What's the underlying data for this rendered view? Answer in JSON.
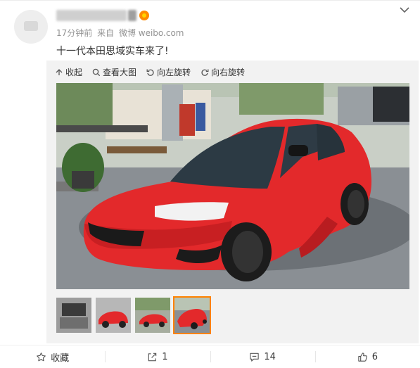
{
  "post": {
    "time_ago": "17分钟前",
    "source_prefix": "来自",
    "source": "微博 weibo.com",
    "text": "十一代本田思域实车来了!"
  },
  "toolbar": {
    "collapse": "收起",
    "view_large": "查看大图",
    "rotate_left": "向左旋转",
    "rotate_right": "向右旋转"
  },
  "actions": {
    "favorite": "收藏",
    "repost_count": "1",
    "comment_count": "14",
    "like_count": "6"
  },
  "thumbnails": {
    "count": 4,
    "selected_index": 3
  },
  "colors": {
    "accent": "#ff8200",
    "car": "#e3292b",
    "meta_text": "#939393"
  }
}
